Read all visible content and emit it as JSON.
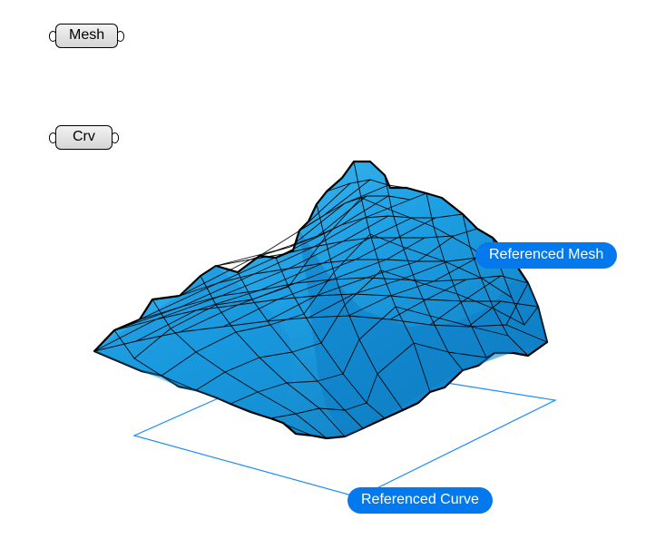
{
  "nodes": {
    "mesh": {
      "label": "Mesh"
    },
    "curve": {
      "label": "Crv"
    }
  },
  "annotations": {
    "referenced_mesh": "Referenced Mesh",
    "referenced_curve": "Referenced Curve"
  },
  "mesh_visual": {
    "fill_color": "#28a9e8",
    "edge_color": "#0a0a0a",
    "outline_color": "#000000"
  },
  "curve_visual": {
    "stroke_color": "#1e8bff"
  }
}
